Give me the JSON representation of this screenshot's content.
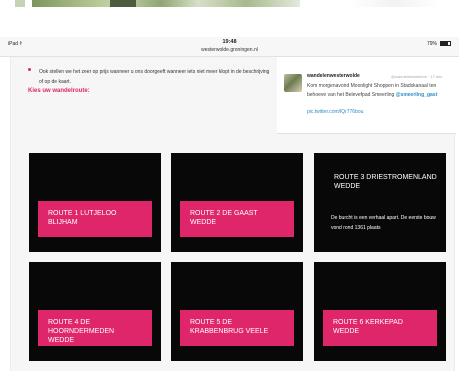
{
  "status_bar": {
    "device": "iPad",
    "wifi_icon": "wifi-icon",
    "time": "19:48",
    "url": "westerwolde.groningen.nl",
    "battery": "79%",
    "battery_icon": "battery-icon"
  },
  "content": {
    "info_text": "Ook stellen we het zeer op prijs wanneer u ons doorgeeft wanneer iets niet meer klopt in de beschrijving of op de kaart.",
    "route_heading": "Kies uw wandelroute:"
  },
  "tweet": {
    "user": "wandelenwesterwolde",
    "handle": "@wandelenwesterw · 17 dec",
    "body": "Kom morgenavond Moonlight Shoppen in Stadskanaal ten behoeve van het Belevefpad Smeerling ",
    "mention": "@smeerling_gast",
    "link": "pic.twitter.com/lQr776bou"
  },
  "routes": [
    {
      "label": "ROUTE 1 LUTJELOO BLIJHAM"
    },
    {
      "label": "ROUTE 2 DE GAAST WEDDE"
    },
    {
      "label": "ROUTE 3 DRIESTROMENLAND WEDDE",
      "desc": "De burcht is een verhaal apart. De eerste bouw vond rond 1361 plaats"
    },
    {
      "label": "ROUTE 4 DE HOORNDERMEDEN WEDDE"
    },
    {
      "label": "ROUTE 5 DE KRABBENBRUG VEELE"
    },
    {
      "label": "ROUTE 6 KERKEPAD WEDDE"
    }
  ],
  "colors": {
    "accent": "#e0266b",
    "tile": "#080808",
    "link": "#2b8fc5"
  }
}
